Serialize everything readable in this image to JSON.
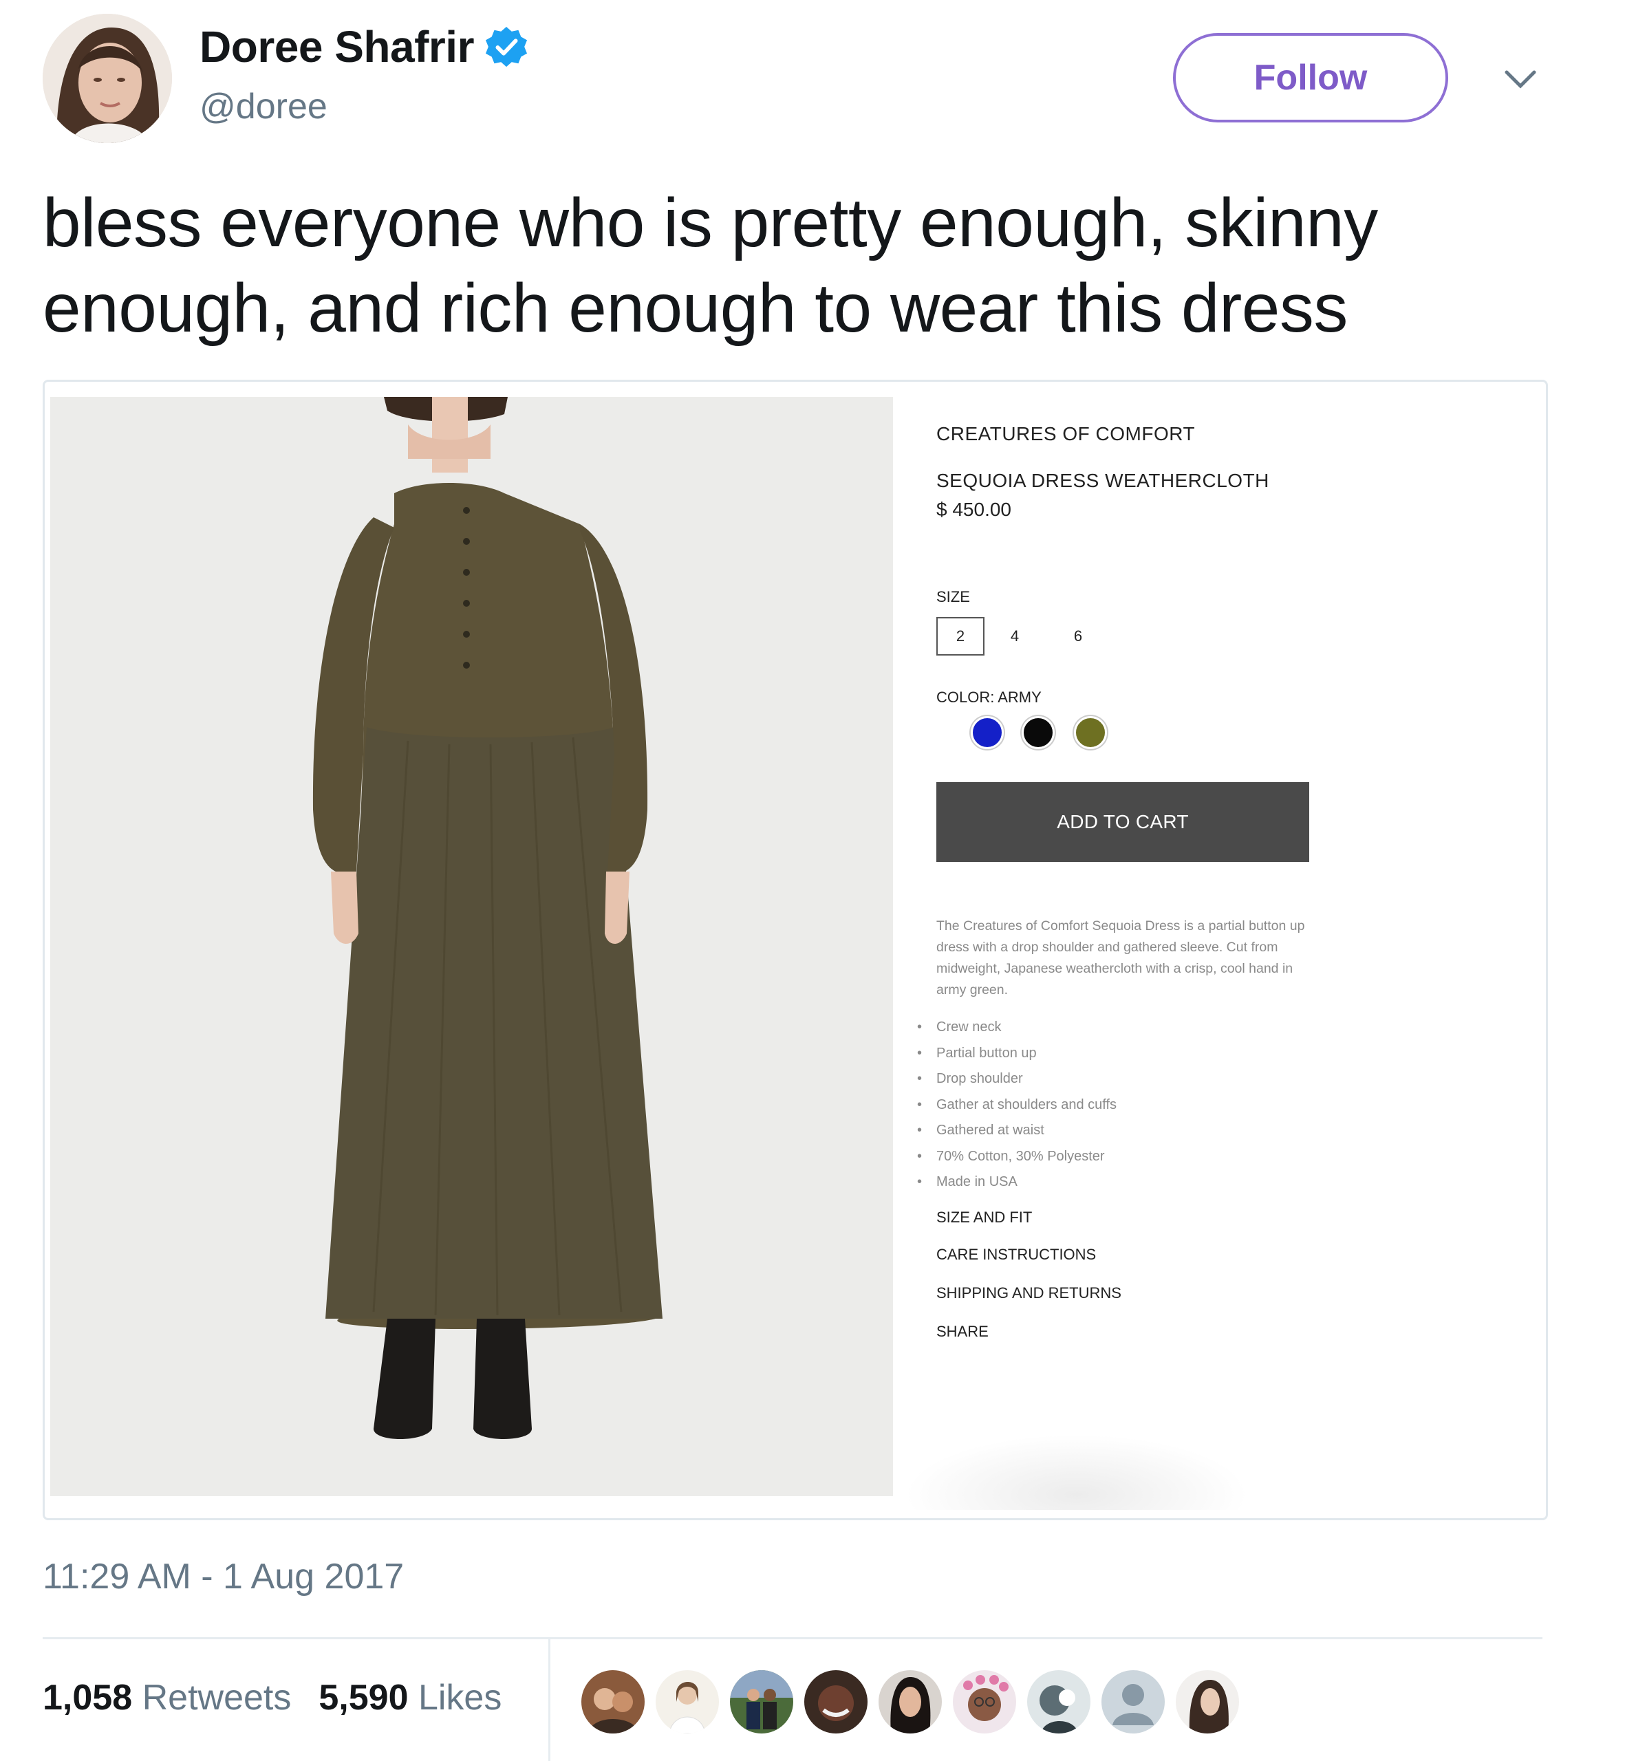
{
  "header": {
    "display_name": "Doree Shafrir",
    "handle": "@doree",
    "follow_label": "Follow",
    "verified_icon": "verified-badge-icon",
    "caret_icon": "chevron-down-icon"
  },
  "tweet": {
    "text": "bless everyone who is pretty enough, skinny enough, and rich enough to wear this dress",
    "timestamp": "11:29 AM - 1 Aug 2017"
  },
  "product": {
    "brand": "CREATURES OF COMFORT",
    "name": "SEQUOIA DRESS WEATHERCLOTH",
    "price": "$ 450.00",
    "size_label": "SIZE",
    "sizes": [
      "2",
      "4",
      "6"
    ],
    "selected_size": "2",
    "color_label": "COLOR: ARMY",
    "colors": [
      {
        "name": "blue",
        "hex": "#1420c8"
      },
      {
        "name": "black",
        "hex": "#0a0a0a"
      },
      {
        "name": "army",
        "hex": "#6e7022"
      }
    ],
    "add_to_cart": "ADD TO CART",
    "description": "The Creatures of Comfort Sequoia Dress is a partial button up dress with a drop shoulder and gathered sleeve. Cut from midweight, Japanese weathercloth with a crisp, cool hand in army green.",
    "features": [
      "Crew neck",
      "Partial button up",
      "Drop shoulder",
      "Gather at shoulders and cuffs",
      "Gathered at waist",
      "70% Cotton, 30% Polyester",
      "Made in USA"
    ],
    "links": {
      "size_fit": "SIZE AND FIT",
      "care": "CARE INSTRUCTIONS",
      "shipping": "SHIPPING AND RETURNS",
      "share": "SHARE"
    }
  },
  "stats": {
    "retweets_count": "1,058",
    "retweets_label": "Retweets",
    "likes_count": "5,590",
    "likes_label": "Likes"
  },
  "colors": {
    "follow_accent": "#7e5bc8",
    "verified_blue": "#1da1f2",
    "meta_gray": "#657786",
    "cart_button": "#4a4a4a",
    "dress": "#5b5236"
  }
}
